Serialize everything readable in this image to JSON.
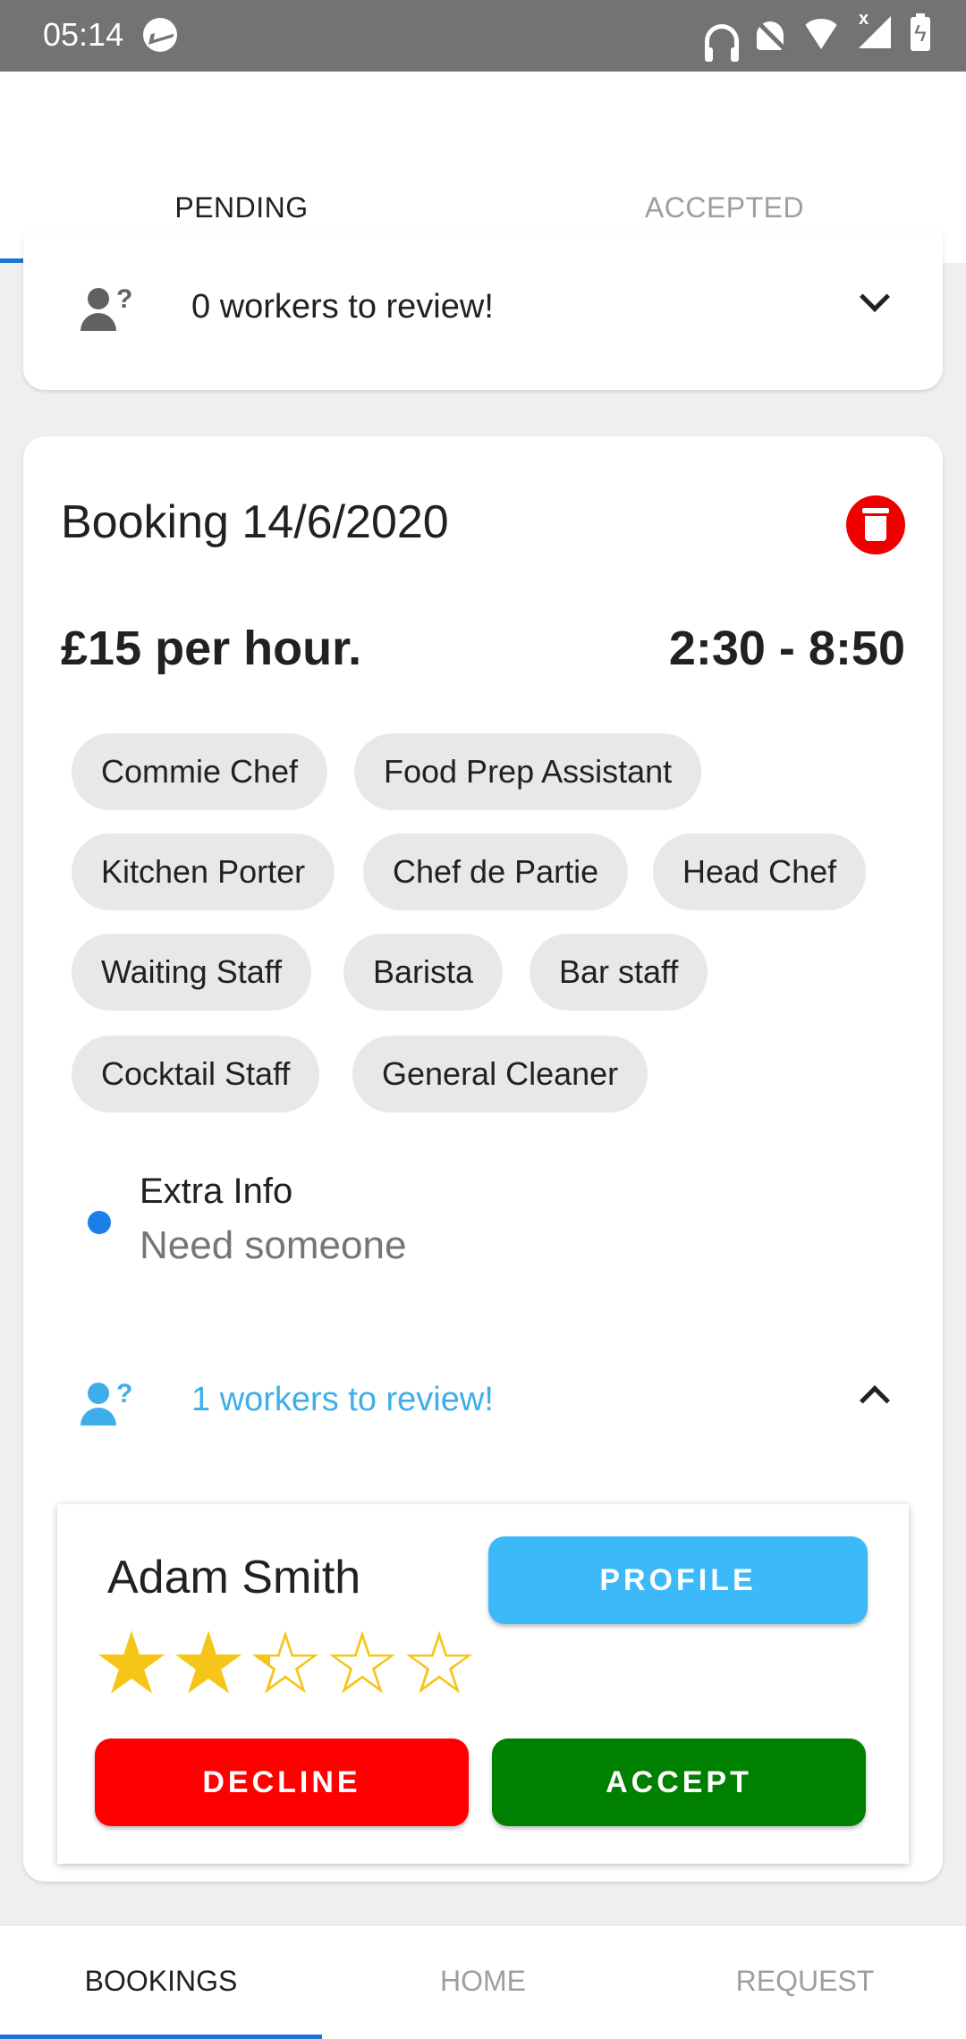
{
  "status_bar": {
    "time": "05:14",
    "icons": [
      "messenger-icon",
      "headset-icon",
      "bell-off-icon",
      "wifi-icon",
      "signal-icon",
      "battery-charging-icon"
    ]
  },
  "tabs": [
    {
      "label": "PENDING",
      "active": true
    },
    {
      "label": "ACCEPTED",
      "active": false
    }
  ],
  "previous_card": {
    "review_text": "0 workers to review!"
  },
  "booking": {
    "title": "Booking 14/6/2020",
    "rate": "£15 per hour.",
    "time": "2:30 - 8:50",
    "roles": [
      "Commie Chef",
      "Food Prep Assistant",
      "Kitchen Porter",
      "Chef de Partie",
      "Head Chef",
      "Waiting Staff",
      "Barista",
      "Bar staff",
      "Cocktail Staff",
      "General Cleaner"
    ],
    "extra_info_title": "Extra Info",
    "extra_info_value": "Need someone",
    "review_text": "1 workers to review!",
    "worker": {
      "name": "Adam Smith",
      "rating": 2.3,
      "rating_max": 5,
      "profile_label": "PROFILE",
      "decline_label": "DECLINE",
      "accept_label": "ACCEPT"
    }
  },
  "bottom_nav": [
    {
      "label": "BOOKINGS",
      "active": true
    },
    {
      "label": "HOME",
      "active": false
    },
    {
      "label": "REQUEST",
      "active": false
    }
  ],
  "colors": {
    "accent": "#1976d2",
    "profile": "#3cb9f8",
    "decline": "#ff0000",
    "accept": "#008000",
    "star": "#f5c518",
    "delete": "#ee0000",
    "link": "#3daee9"
  }
}
